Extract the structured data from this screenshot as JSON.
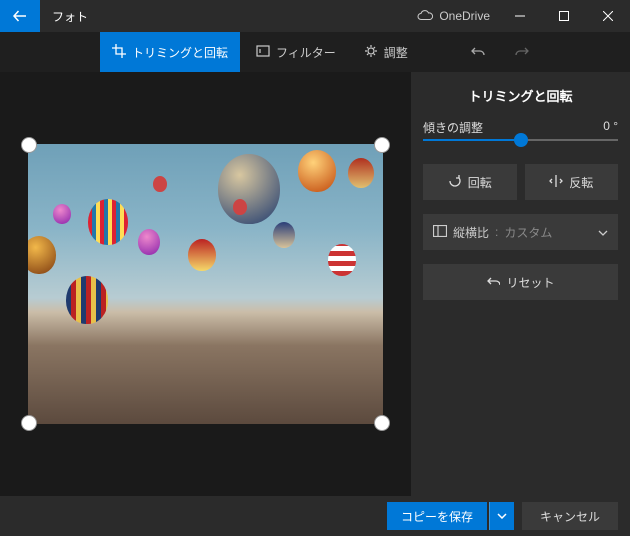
{
  "app_title": "フォト",
  "onedrive_label": "OneDrive",
  "tabs": {
    "crop": "トリミングと回転",
    "filter": "フィルター",
    "adjust": "調整"
  },
  "side": {
    "title": "トリミングと回転",
    "tilt_label": "傾きの調整",
    "tilt_value": "0 °",
    "rotate": "回転",
    "flip": "反転",
    "aspect_label": "縦横比",
    "aspect_sep": " : ",
    "aspect_value": "カスタム",
    "reset": "リセット"
  },
  "footer": {
    "save": "コピーを保存",
    "cancel": "キャンセル"
  }
}
